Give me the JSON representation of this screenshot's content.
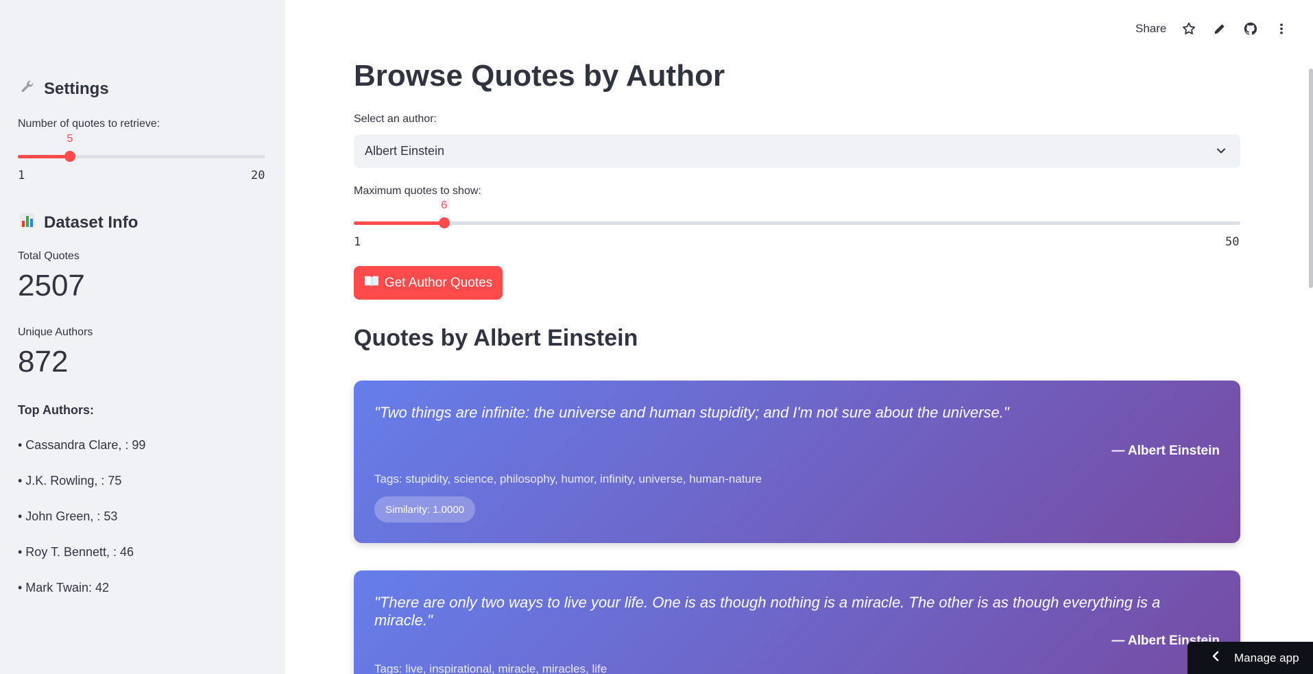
{
  "sidebar": {
    "settings_title": "Settings",
    "settings_icon": "wrench-icon",
    "num_quotes_label": "Number of quotes to retrieve:",
    "num_quotes_slider": {
      "value": "5",
      "min": "1",
      "max": "20",
      "fraction": 0.2105
    },
    "dataset_title": "Dataset Info",
    "dataset_icon": "bar-chart-icon",
    "total_quotes_label": "Total Quotes",
    "total_quotes_value": "2507",
    "unique_authors_label": "Unique Authors",
    "unique_authors_value": "872",
    "top_authors_title": "Top Authors:",
    "top_authors": [
      "• Cassandra Clare, : 99",
      "• J.K. Rowling, : 75",
      "• John Green, : 53",
      "• Roy T. Bennett, : 46",
      "• Mark Twain: 42"
    ]
  },
  "toolbar": {
    "share_label": "Share",
    "icons": [
      "star-icon",
      "pencil-icon",
      "github-icon",
      "more-vertical-icon"
    ]
  },
  "main": {
    "title": "Browse Quotes by Author",
    "select_label": "Select an author:",
    "selected_author": "Albert Einstein",
    "max_quotes_label": "Maximum quotes to show:",
    "max_quotes_slider": {
      "value": "6",
      "min": "1",
      "max": "50",
      "fraction": 0.102
    },
    "button_label": "Get Author Quotes",
    "section_title": "Quotes by Albert Einstein",
    "quotes": [
      {
        "text": "\"Two things are infinite: the universe and human stupidity; and I'm not sure about the universe.\"",
        "author": "— Albert Einstein",
        "tags": "Tags: stupidity, science, philosophy, humor, infinity, universe, human-nature",
        "similarity": "Similarity: 1.0000"
      },
      {
        "text": "\"There are only two ways to live your life. One is as though nothing is a miracle. The other is as though everything is a miracle.\"",
        "author": "— Albert Einstein",
        "tags": "Tags: live, inspirational, miracle, miracles, life"
      }
    ]
  },
  "manage_app_label": "Manage app",
  "colors": {
    "accent": "#ff4b4b",
    "sidebar_bg": "#f0f2f6",
    "card_start": "#667eea",
    "card_end": "#764ba2"
  }
}
